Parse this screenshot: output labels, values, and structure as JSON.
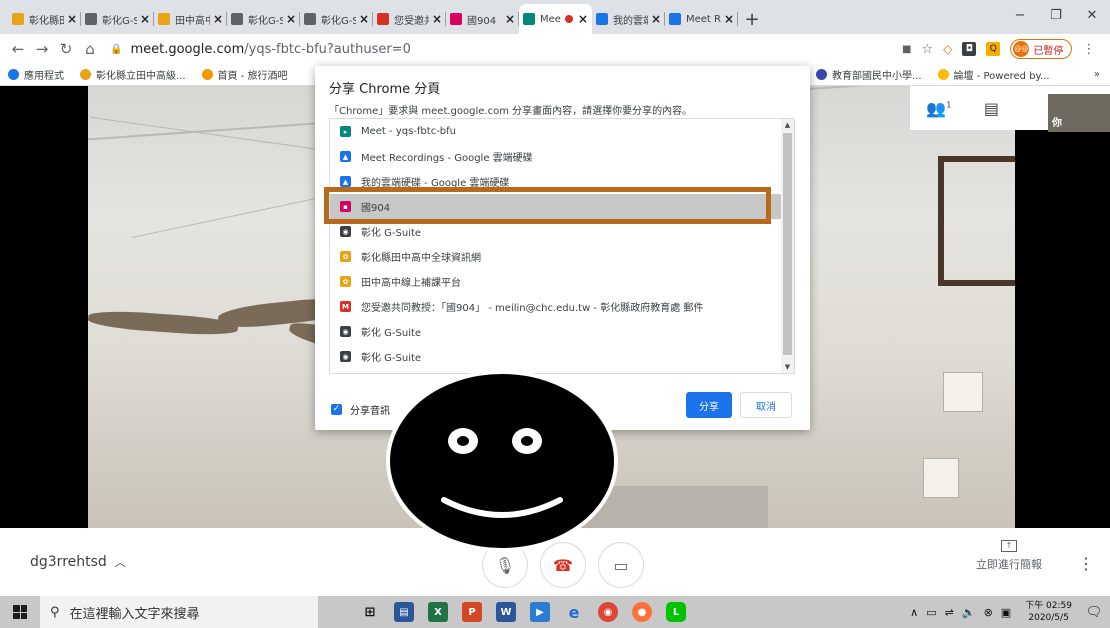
{
  "tabs": [
    {
      "title": "彰化縣田",
      "icon": "flower-icon",
      "color": "#e8a317"
    },
    {
      "title": "彰化G-S",
      "icon": "globe-icon",
      "color": "#5f6368"
    },
    {
      "title": "田中高中",
      "icon": "flower-icon",
      "color": "#e8a317"
    },
    {
      "title": "彰化G-S",
      "icon": "globe-icon",
      "color": "#5f6368"
    },
    {
      "title": "彰化G-S",
      "icon": "globe-icon",
      "color": "#5f6368"
    },
    {
      "title": "您受邀共",
      "icon": "gmail-icon",
      "color": "#d93025"
    },
    {
      "title": "國904",
      "icon": "classroom-icon",
      "color": "#d5005f"
    },
    {
      "title": "Mee",
      "icon": "meet-icon",
      "color": "#00897b",
      "active": true
    },
    {
      "title": "我的雲端",
      "icon": "drive-icon",
      "color": "#1a73e8"
    },
    {
      "title": "Meet Re",
      "icon": "drive-icon",
      "color": "#1a73e8"
    }
  ],
  "newtab_label": "+",
  "window_controls": {
    "minimize": "−",
    "restore": "❐",
    "close": "✕"
  },
  "address": {
    "host": "meet.google.com",
    "path": "/yqs-fbtc-bfu?authuser=0"
  },
  "profile": {
    "avatar": "@@",
    "status": "已暫停"
  },
  "bookmarks": [
    {
      "label": "應用程式",
      "color": "#1a73e8"
    },
    {
      "label": "彰化縣立田中高級...",
      "color": "#e8a317"
    },
    {
      "label": "首頁 - 旅行酒吧",
      "color": "#f29900"
    }
  ],
  "bookmarks_right": [
    {
      "label": "教育部國民中小學...",
      "color": "#3949ab"
    },
    {
      "label": "論壇 - Powered by...",
      "color": "#fbbc04"
    }
  ],
  "bookmarks_overflow": "»",
  "meet_topbar": {
    "people_icon": "👥",
    "people_count": "1",
    "chat_icon": "▤",
    "self_label": "你"
  },
  "share_dialog": {
    "title": "分享 Chrome 分頁",
    "description": "「Chrome」要求與 meet.google.com 分享畫面內容，請選擇你要分享的內容。",
    "items": [
      {
        "label": "Meet - yqs-fbtc-bfu",
        "icon": "meet-icon",
        "color": "#00897b",
        "glyph": "▸"
      },
      {
        "label": "Meet Recordings - Google 雲端硬碟",
        "icon": "drive-icon",
        "color": "#1a73e8",
        "glyph": "▲"
      },
      {
        "label": "我的雲端硬碟 - Google 雲端硬碟",
        "icon": "drive-icon",
        "color": "#1a73e8",
        "glyph": "▲"
      },
      {
        "label": "國904",
        "icon": "classroom-icon",
        "color": "#d5005f",
        "glyph": "▪",
        "selected": true
      },
      {
        "label": "彰化 G-Suite",
        "icon": "globe-icon",
        "color": "#3c4043",
        "glyph": "◉"
      },
      {
        "label": "彰化縣田中高中全球資訊網",
        "icon": "flower-icon",
        "color": "#e8a317",
        "glyph": "✿"
      },
      {
        "label": "田中高中線上補課平台",
        "icon": "flower-icon",
        "color": "#e8a317",
        "glyph": "✿"
      },
      {
        "label": "您受邀共同教授：「國904」 - meilin@chc.edu.tw - 彰化縣政府教育處 郵件",
        "icon": "gmail-icon",
        "color": "#d93025",
        "glyph": "M"
      },
      {
        "label": "彰化 G-Suite",
        "icon": "globe-icon",
        "color": "#3c4043",
        "glyph": "◉"
      },
      {
        "label": "彰化 G-Suite",
        "icon": "globe-icon",
        "color": "#3c4043",
        "glyph": "◉"
      }
    ],
    "share_audio_label": "分享音訊",
    "share_button": "分享",
    "cancel_button": "取消"
  },
  "meetbar": {
    "meeting_code": "dg3rrehtsd",
    "present_label": "立即進行簡報"
  },
  "taskbar": {
    "search_placeholder": "在這裡輸入文字來搜尋",
    "time": "下午 02:59",
    "date": "2020/5/5"
  }
}
